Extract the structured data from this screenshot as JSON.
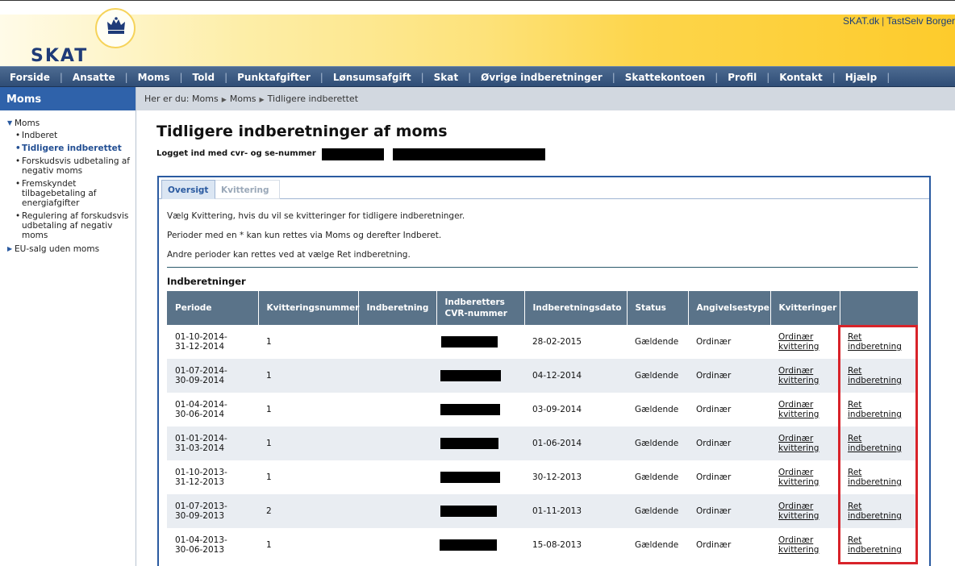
{
  "header": {
    "logo_text": "SKAT",
    "toplinks": [
      "SKAT.dk",
      "TastSelv Borger"
    ],
    "colors": {
      "brand_blue": "#1f3b78",
      "header_yellow": "#fdcb2c"
    }
  },
  "nav": {
    "items": [
      "Forside",
      "Ansatte",
      "Moms",
      "Told",
      "Punktafgifter",
      "Lønsumsafgift",
      "Skat",
      "Øvrige indberetninger",
      "Skattekontoen",
      "Profil",
      "Kontakt",
      "Hjælp"
    ]
  },
  "sidebar": {
    "title": "Moms",
    "items": [
      {
        "label": "Moms",
        "level": 1,
        "expanded": true
      },
      {
        "label": "Indberet",
        "level": 2
      },
      {
        "label": "Tidligere indberettet",
        "level": 2,
        "active": true
      },
      {
        "label": "Forskudsvis udbetaling af negativ moms",
        "level": 2
      },
      {
        "label": "Fremskyndet tilbagebetaling af energiafgifter",
        "level": 2
      },
      {
        "label": "Regulering af forskudsvis udbetaling af negativ moms",
        "level": 2
      },
      {
        "label": "EU-salg uden moms",
        "level": 1,
        "expanded": false
      }
    ]
  },
  "breadcrumb": {
    "prefix": "Her er du:",
    "items": [
      "Moms",
      "Moms",
      "Tidligere indberettet"
    ]
  },
  "main": {
    "title": "Tidligere indberetninger af moms",
    "login_label": "Logget ind med cvr- og se-nummer",
    "tabs": [
      {
        "label": "Oversigt",
        "active": true
      },
      {
        "label": "Kvittering",
        "active": false
      }
    ],
    "info": [
      "Vælg Kvittering, hvis du vil se kvitteringer for tidligere indberetninger.",
      "Perioder med en * kan kun rettes via Moms og derefter Indberet.",
      "Andre perioder kan rettes ved at vælge Ret indberetning."
    ],
    "section_title": "Indberetninger",
    "table": {
      "headers": [
        "Periode",
        "Kvitteringsnummer",
        "Indberetning",
        "Indberetters CVR-nummer",
        "Indberetningsdato",
        "Status",
        "Angivelsestype",
        "Kvitteringer",
        ""
      ],
      "rows": [
        {
          "period_from": "01-10-2014-",
          "period_to": "31-12-2014",
          "kvittnr": "1",
          "indberetning": "",
          "date": "28-02-2015",
          "status": "Gældende",
          "type": "Ordinær",
          "kvitt_link_1": "Ordinær",
          "kvitt_link_2": "kvittering",
          "ret_1": "Ret",
          "ret_2": "indberetning"
        },
        {
          "period_from": "01-07-2014-",
          "period_to": "30-09-2014",
          "kvittnr": "1",
          "indberetning": "",
          "date": "04-12-2014",
          "status": "Gældende",
          "type": "Ordinær",
          "kvitt_link_1": "Ordinær",
          "kvitt_link_2": "kvittering",
          "ret_1": "Ret",
          "ret_2": "indberetning"
        },
        {
          "period_from": "01-04-2014-",
          "period_to": "30-06-2014",
          "kvittnr": "1",
          "indberetning": "",
          "date": "03-09-2014",
          "status": "Gældende",
          "type": "Ordinær",
          "kvitt_link_1": "Ordinær",
          "kvitt_link_2": "kvittering",
          "ret_1": "Ret",
          "ret_2": "indberetning"
        },
        {
          "period_from": "01-01-2014-",
          "period_to": "31-03-2014",
          "kvittnr": "1",
          "indberetning": "",
          "date": "01-06-2014",
          "status": "Gældende",
          "type": "Ordinær",
          "kvitt_link_1": "Ordinær",
          "kvitt_link_2": "kvittering",
          "ret_1": "Ret",
          "ret_2": "indberetning"
        },
        {
          "period_from": "01-10-2013-",
          "period_to": "31-12-2013",
          "kvittnr": "1",
          "indberetning": "",
          "date": "30-12-2013",
          "status": "Gældende",
          "type": "Ordinær",
          "kvitt_link_1": "Ordinær",
          "kvitt_link_2": "kvittering",
          "ret_1": "Ret",
          "ret_2": "indberetning"
        },
        {
          "period_from": "01-07-2013-",
          "period_to": "30-09-2013",
          "kvittnr": "2",
          "indberetning": "",
          "date": "01-11-2013",
          "status": "Gældende",
          "type": "Ordinær",
          "kvitt_link_1": "Ordinær",
          "kvitt_link_2": "kvittering",
          "ret_1": "Ret",
          "ret_2": "indberetning"
        },
        {
          "period_from": "01-04-2013-",
          "period_to": "30-06-2013",
          "kvittnr": "1",
          "indberetning": "",
          "date": "15-08-2013",
          "status": "Gældende",
          "type": "Ordinær",
          "kvitt_link_1": "Ordinær",
          "kvitt_link_2": "kvittering",
          "ret_1": "Ret",
          "ret_2": "indberetning"
        }
      ]
    },
    "highlight_color": "#d8232a"
  }
}
